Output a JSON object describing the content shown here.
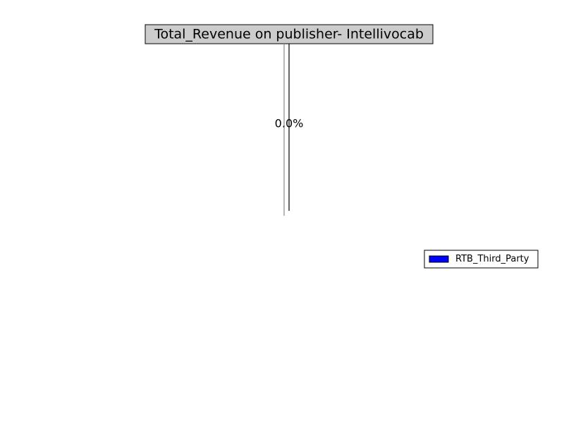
{
  "chart_data": {
    "type": "pie",
    "title": "Total_Revenue on publisher- Intellivocab",
    "slices": [
      {
        "label": "RTB_Third_Party",
        "value": 0.0,
        "percent_label": "0.0%",
        "color": "#0000ff"
      }
    ],
    "legend": {
      "placement": "right",
      "entries": [
        "RTB_Third_Party"
      ]
    }
  },
  "colors": {
    "title_box_fill": "#cccccc",
    "edge": "#000000",
    "background": "#ffffff"
  }
}
